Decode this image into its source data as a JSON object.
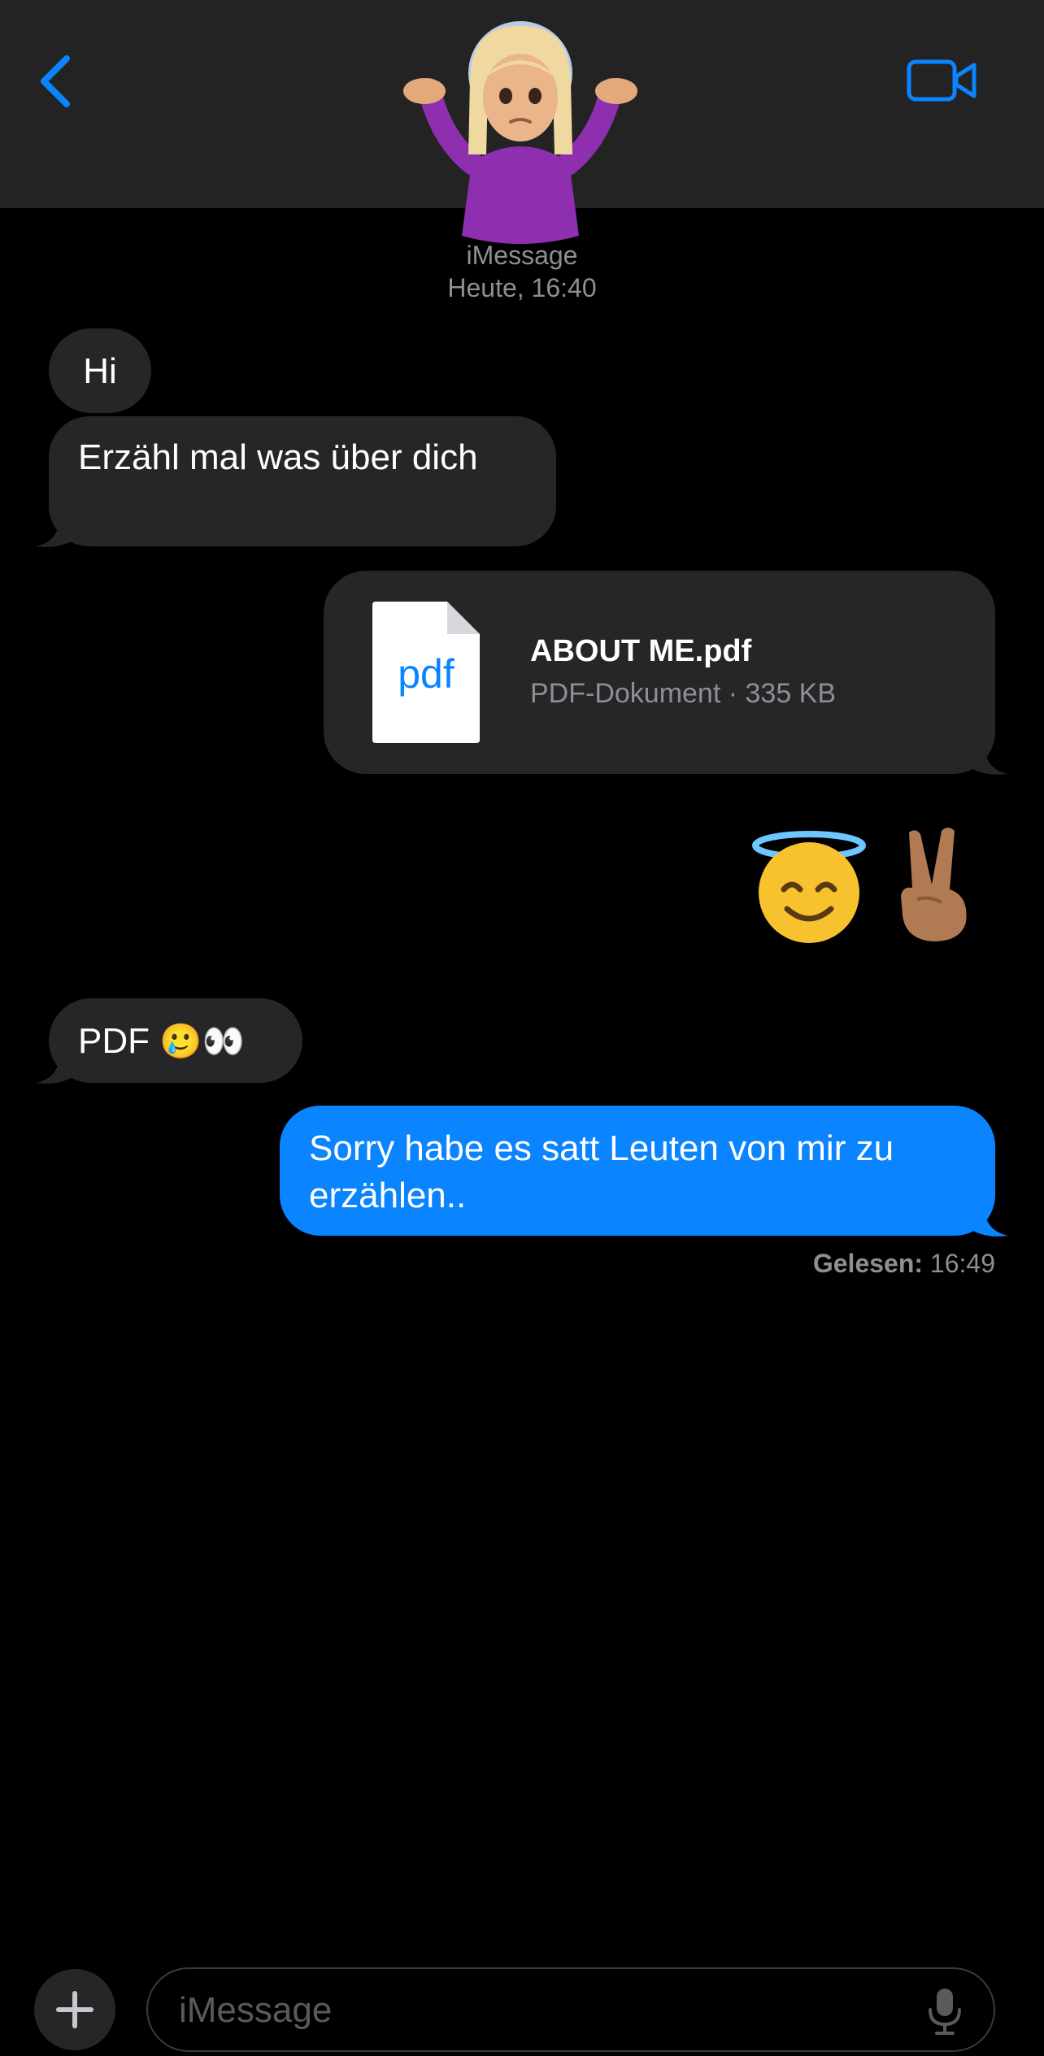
{
  "header": {
    "contact_avatar_emoji": "🤷🏼‍♀️",
    "service_label": "iMessage",
    "timestamp": "Heute, 16:40"
  },
  "messages": [
    {
      "direction": "incoming",
      "text": "Hi"
    },
    {
      "direction": "incoming",
      "text": "Erzähl mal was über dich"
    },
    {
      "direction": "outgoing",
      "type": "file",
      "file_icon_label": "pdf",
      "file_name": "ABOUT ME.pdf",
      "file_info": "PDF-Dokument · 335 KB"
    },
    {
      "direction": "outgoing",
      "type": "emoji",
      "emojis": [
        "😇",
        "✌🏽"
      ]
    },
    {
      "direction": "incoming",
      "text": "PDF",
      "emojis": "🥲👀"
    },
    {
      "direction": "outgoing",
      "text": "Sorry habe es satt Leuten von mir zu erzählen.."
    }
  ],
  "read_receipt": {
    "label": "Gelesen:",
    "time": "16:49"
  },
  "composer": {
    "placeholder": "iMessage"
  },
  "colors": {
    "accent": "#0a84ff",
    "incoming_bubble": "#262628",
    "header_bg": "#232323",
    "secondary_text": "#8e8e93"
  },
  "icons": {
    "back": "chevron-left-icon",
    "video": "video-camera-icon",
    "plus": "plus-icon",
    "mic": "microphone-icon",
    "file": "document-icon"
  }
}
